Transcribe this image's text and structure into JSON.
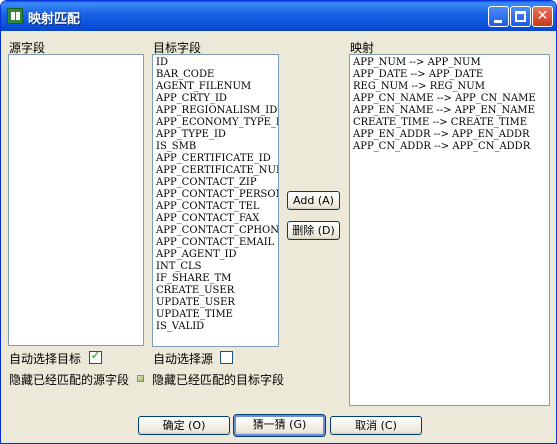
{
  "window": {
    "title": "映射匹配",
    "icon": "grid-app-icon",
    "controls": {
      "minimize": "minimize-icon",
      "maximize": "maximize-icon",
      "close_glyph": "✕"
    }
  },
  "source": {
    "label": "源字段",
    "items": []
  },
  "target": {
    "label": "目标字段",
    "items": [
      "ID",
      "BAR_CODE",
      "AGENT_FILENUM",
      "APP_CRTY_ID",
      "APP_REGIONALISM_ID",
      "APP_ECONOMY_TYPE_ID",
      "APP_TYPE_ID",
      "IS_SMB",
      "APP_CERTIFICATE_ID",
      "APP_CERTIFICATE_NUM",
      "APP_CONTACT_ZIP",
      "APP_CONTACT_PERSON",
      "APP_CONTACT_TEL",
      "APP_CONTACT_FAX",
      "APP_CONTACT_CPHONE",
      "APP_CONTACT_EMAIL",
      "APP_AGENT_ID",
      "INT_CLS",
      "IF_SHARE_TM",
      "CREATE_USER",
      "UPDATE_USER",
      "UPDATE_TIME",
      "IS_VALID"
    ]
  },
  "mapping": {
    "label": "映射",
    "items": [
      "APP_NUM --> APP_NUM",
      "APP_DATE --> APP_DATE",
      "REG_NUM --> REG_NUM",
      "APP_CN_NAME --> APP_CN_NAME",
      "APP_EN_NAME --> APP_EN_NAME",
      "CREATE_TIME --> CREATE_TIME",
      "APP_EN_ADDR --> APP_EN_ADDR",
      "APP_CN_ADDR --> APP_CN_ADDR"
    ]
  },
  "actions": {
    "add": "Add (A)",
    "delete": "删除 (D)"
  },
  "options": {
    "auto_select_target": {
      "label": "自动选择目标",
      "checked": true
    },
    "auto_select_source": {
      "label": "自动选择源",
      "checked": false
    },
    "hide_matched_source": {
      "label": "隐藏已经匹配的源字段"
    },
    "hide_matched_target": {
      "label": "隐藏已经匹配的目标字段"
    }
  },
  "footer": {
    "ok": "确定 (O)",
    "guess": "猜一猜 (G)",
    "cancel": "取消 (C)"
  }
}
